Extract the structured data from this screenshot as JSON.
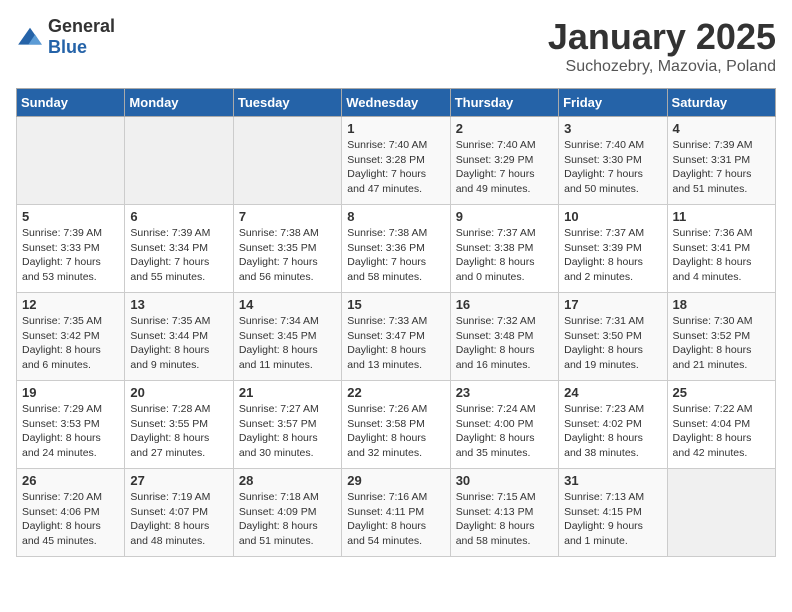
{
  "header": {
    "logo": {
      "general": "General",
      "blue": "Blue"
    },
    "title": "January 2025",
    "subtitle": "Suchozebry, Mazovia, Poland"
  },
  "weekdays": [
    "Sunday",
    "Monday",
    "Tuesday",
    "Wednesday",
    "Thursday",
    "Friday",
    "Saturday"
  ],
  "weeks": [
    [
      {
        "day": "",
        "info": ""
      },
      {
        "day": "",
        "info": ""
      },
      {
        "day": "",
        "info": ""
      },
      {
        "day": "1",
        "info": "Sunrise: 7:40 AM\nSunset: 3:28 PM\nDaylight: 7 hours\nand 47 minutes."
      },
      {
        "day": "2",
        "info": "Sunrise: 7:40 AM\nSunset: 3:29 PM\nDaylight: 7 hours\nand 49 minutes."
      },
      {
        "day": "3",
        "info": "Sunrise: 7:40 AM\nSunset: 3:30 PM\nDaylight: 7 hours\nand 50 minutes."
      },
      {
        "day": "4",
        "info": "Sunrise: 7:39 AM\nSunset: 3:31 PM\nDaylight: 7 hours\nand 51 minutes."
      }
    ],
    [
      {
        "day": "5",
        "info": "Sunrise: 7:39 AM\nSunset: 3:33 PM\nDaylight: 7 hours\nand 53 minutes."
      },
      {
        "day": "6",
        "info": "Sunrise: 7:39 AM\nSunset: 3:34 PM\nDaylight: 7 hours\nand 55 minutes."
      },
      {
        "day": "7",
        "info": "Sunrise: 7:38 AM\nSunset: 3:35 PM\nDaylight: 7 hours\nand 56 minutes."
      },
      {
        "day": "8",
        "info": "Sunrise: 7:38 AM\nSunset: 3:36 PM\nDaylight: 7 hours\nand 58 minutes."
      },
      {
        "day": "9",
        "info": "Sunrise: 7:37 AM\nSunset: 3:38 PM\nDaylight: 8 hours\nand 0 minutes."
      },
      {
        "day": "10",
        "info": "Sunrise: 7:37 AM\nSunset: 3:39 PM\nDaylight: 8 hours\nand 2 minutes."
      },
      {
        "day": "11",
        "info": "Sunrise: 7:36 AM\nSunset: 3:41 PM\nDaylight: 8 hours\nand 4 minutes."
      }
    ],
    [
      {
        "day": "12",
        "info": "Sunrise: 7:35 AM\nSunset: 3:42 PM\nDaylight: 8 hours\nand 6 minutes."
      },
      {
        "day": "13",
        "info": "Sunrise: 7:35 AM\nSunset: 3:44 PM\nDaylight: 8 hours\nand 9 minutes."
      },
      {
        "day": "14",
        "info": "Sunrise: 7:34 AM\nSunset: 3:45 PM\nDaylight: 8 hours\nand 11 minutes."
      },
      {
        "day": "15",
        "info": "Sunrise: 7:33 AM\nSunset: 3:47 PM\nDaylight: 8 hours\nand 13 minutes."
      },
      {
        "day": "16",
        "info": "Sunrise: 7:32 AM\nSunset: 3:48 PM\nDaylight: 8 hours\nand 16 minutes."
      },
      {
        "day": "17",
        "info": "Sunrise: 7:31 AM\nSunset: 3:50 PM\nDaylight: 8 hours\nand 19 minutes."
      },
      {
        "day": "18",
        "info": "Sunrise: 7:30 AM\nSunset: 3:52 PM\nDaylight: 8 hours\nand 21 minutes."
      }
    ],
    [
      {
        "day": "19",
        "info": "Sunrise: 7:29 AM\nSunset: 3:53 PM\nDaylight: 8 hours\nand 24 minutes."
      },
      {
        "day": "20",
        "info": "Sunrise: 7:28 AM\nSunset: 3:55 PM\nDaylight: 8 hours\nand 27 minutes."
      },
      {
        "day": "21",
        "info": "Sunrise: 7:27 AM\nSunset: 3:57 PM\nDaylight: 8 hours\nand 30 minutes."
      },
      {
        "day": "22",
        "info": "Sunrise: 7:26 AM\nSunset: 3:58 PM\nDaylight: 8 hours\nand 32 minutes."
      },
      {
        "day": "23",
        "info": "Sunrise: 7:24 AM\nSunset: 4:00 PM\nDaylight: 8 hours\nand 35 minutes."
      },
      {
        "day": "24",
        "info": "Sunrise: 7:23 AM\nSunset: 4:02 PM\nDaylight: 8 hours\nand 38 minutes."
      },
      {
        "day": "25",
        "info": "Sunrise: 7:22 AM\nSunset: 4:04 PM\nDaylight: 8 hours\nand 42 minutes."
      }
    ],
    [
      {
        "day": "26",
        "info": "Sunrise: 7:20 AM\nSunset: 4:06 PM\nDaylight: 8 hours\nand 45 minutes."
      },
      {
        "day": "27",
        "info": "Sunrise: 7:19 AM\nSunset: 4:07 PM\nDaylight: 8 hours\nand 48 minutes."
      },
      {
        "day": "28",
        "info": "Sunrise: 7:18 AM\nSunset: 4:09 PM\nDaylight: 8 hours\nand 51 minutes."
      },
      {
        "day": "29",
        "info": "Sunrise: 7:16 AM\nSunset: 4:11 PM\nDaylight: 8 hours\nand 54 minutes."
      },
      {
        "day": "30",
        "info": "Sunrise: 7:15 AM\nSunset: 4:13 PM\nDaylight: 8 hours\nand 58 minutes."
      },
      {
        "day": "31",
        "info": "Sunrise: 7:13 AM\nSunset: 4:15 PM\nDaylight: 9 hours\nand 1 minute."
      },
      {
        "day": "",
        "info": ""
      }
    ]
  ]
}
